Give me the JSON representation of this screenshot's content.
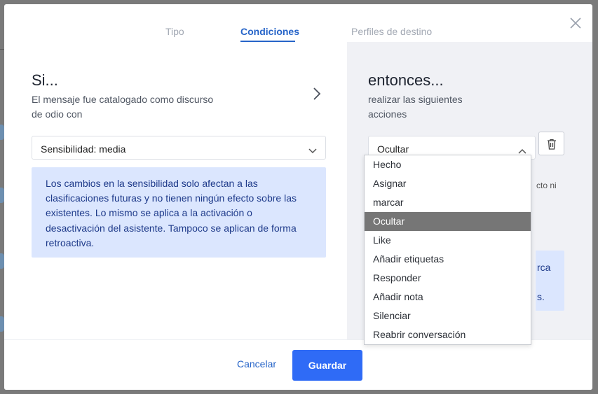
{
  "tabs": [
    {
      "label": "Tipo",
      "active": false
    },
    {
      "label": "Condiciones",
      "active": true
    },
    {
      "label": "Perfiles de destino",
      "active": false
    }
  ],
  "condition": {
    "heading": "Si...",
    "description_line1": "El mensaje fue catalogado como discurso",
    "description_line2": "de odio con",
    "select_value": "Sensibilidad: media",
    "note_lines": [
      "Los cambios en la sensibilidad solo afectan a las",
      "clasificaciones futuras y no tienen ningún efecto sobre las",
      "existentes. Lo mismo se aplica a la activación o",
      "desactivación del asistente. Tampoco se aplican de forma",
      "retroactiva."
    ]
  },
  "action": {
    "heading": "entonces...",
    "description_line1": "realizar las siguientes",
    "description_line2": "acciones",
    "select_value": "Ocultar",
    "partial_text": "cto ni",
    "partial_note_line1": "rca",
    "partial_note_line2": "s."
  },
  "dropdown": {
    "selected": "Ocultar",
    "options": [
      "Hecho",
      "Asignar",
      "marcar",
      "Ocultar",
      "Like",
      "Añadir etiquetas",
      "Responder",
      "Añadir nota",
      "Silenciar",
      "Reabrir conversación"
    ]
  },
  "footer": {
    "cancel_label": "Cancelar",
    "save_label": "Guardar"
  },
  "colors": {
    "accent": "#2664c8",
    "primary_button": "#2f6bf6",
    "note_background": "#dbe6fe",
    "selected_option": "#767676"
  },
  "icons": {
    "close": "close-icon",
    "chevron_right": "chevron-right-icon",
    "chevron_down": "chevron-down-icon",
    "chevron_up": "chevron-up-icon",
    "trash": "trash-icon"
  }
}
